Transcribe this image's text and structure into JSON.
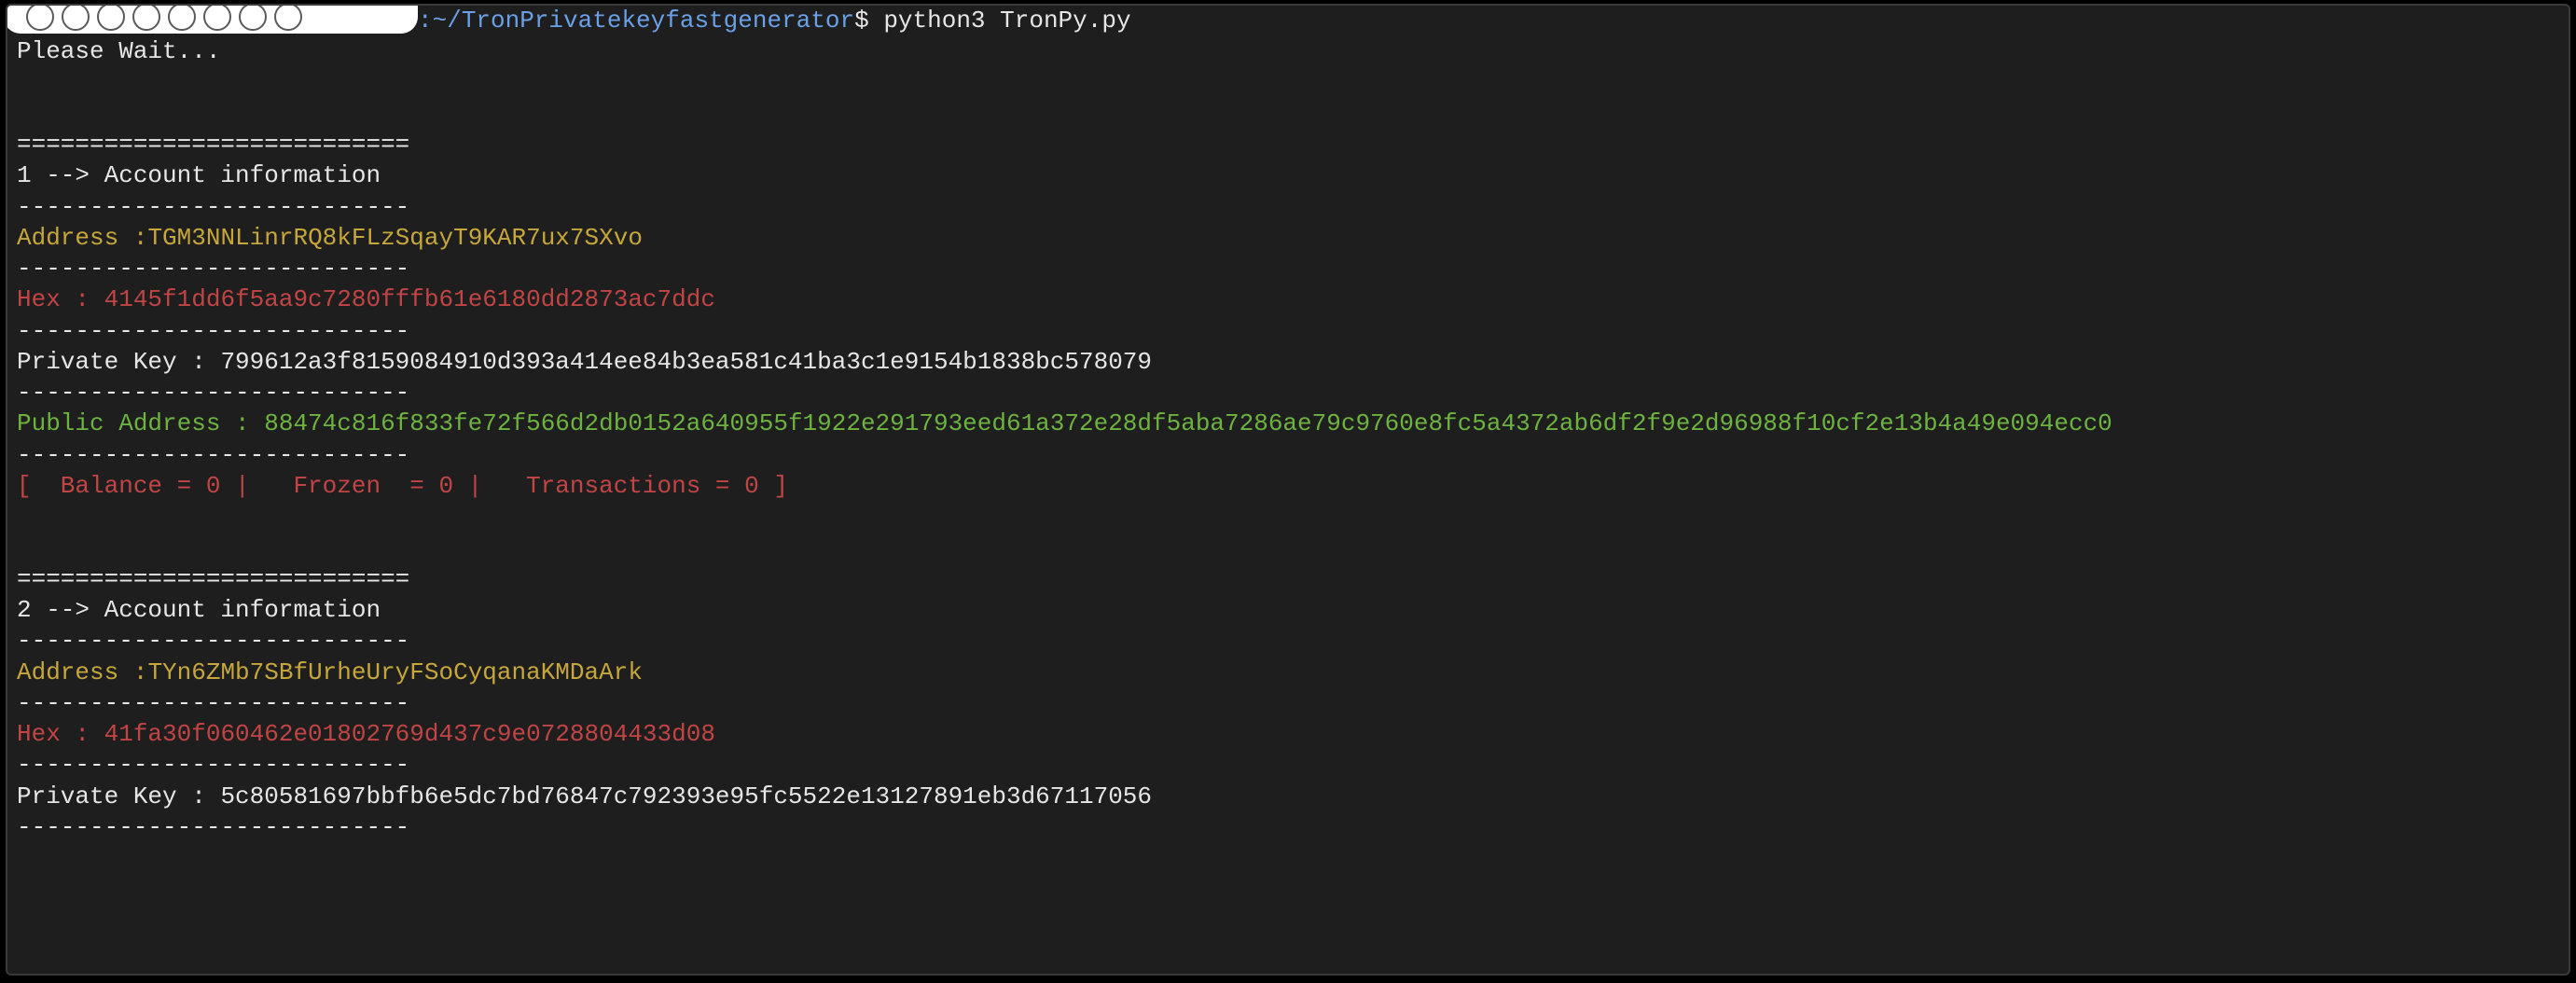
{
  "prompt": {
    "path_sep": ":",
    "path": "~/TronPrivatekeyfastgenerator",
    "dollar": "$",
    "command": "python3 TronPy.py"
  },
  "wait_text": "Please Wait...",
  "sep_double": "===========================",
  "sep_single": "---------------------------",
  "accounts": [
    {
      "header": "1 --> Account information",
      "address_label": "Address :",
      "address": "TGM3NNLinrRQ8kFLzSqayT9KAR7ux7SXvo",
      "hex_label": "Hex : ",
      "hex": "4145f1dd6f5aa9c7280fffb61e6180dd2873ac7ddc",
      "privkey_label": "Private Key : ",
      "privkey": "799612a3f8159084910d393a414ee84b3ea581c41ba3c1e9154b1838bc578079",
      "pubaddr_label": "Public Address : ",
      "pubaddr": "88474c816f833fe72f566d2db0152a640955f1922e291793eed61a372e28df5aba7286ae79c9760e8fc5a4372ab6df2f9e2d96988f10cf2e13b4a49e094ecc0",
      "stats": "[  Balance = 0 |   Frozen  = 0 |   Transactions = 0 ]"
    },
    {
      "header": "2 --> Account information",
      "address_label": "Address :",
      "address": "TYn6ZMb7SBfUrheUryFSoCyqanaKMDaArk",
      "hex_label": "Hex : ",
      "hex": "41fa30f060462e01802769d437c9e0728804433d08",
      "privkey_label": "Private Key : ",
      "privkey": "5c80581697bbfb6e5dc7bd76847c792393e95fc5522e13127891eb3d67117056"
    }
  ]
}
